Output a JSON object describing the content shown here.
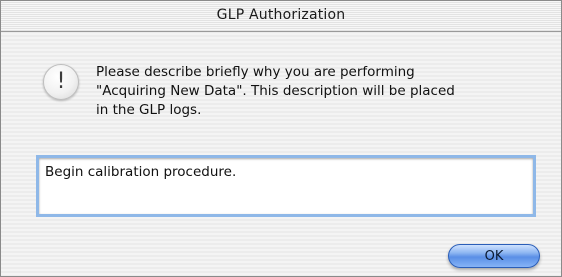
{
  "window": {
    "title": "GLP Authorization"
  },
  "alert": {
    "icon": "exclamation-alert-icon",
    "icon_glyph": "!",
    "message_line1": "Please describe briefly why you are performing",
    "message_line2": "\"Acquiring New Data\".  This description will be placed",
    "message_line3": "in the GLP logs."
  },
  "description_field": {
    "value": "Begin calibration procedure."
  },
  "buttons": {
    "ok_label": "OK"
  },
  "colors": {
    "focus_ring": "#8fb8e8",
    "default_button": "#5a8fe6"
  }
}
